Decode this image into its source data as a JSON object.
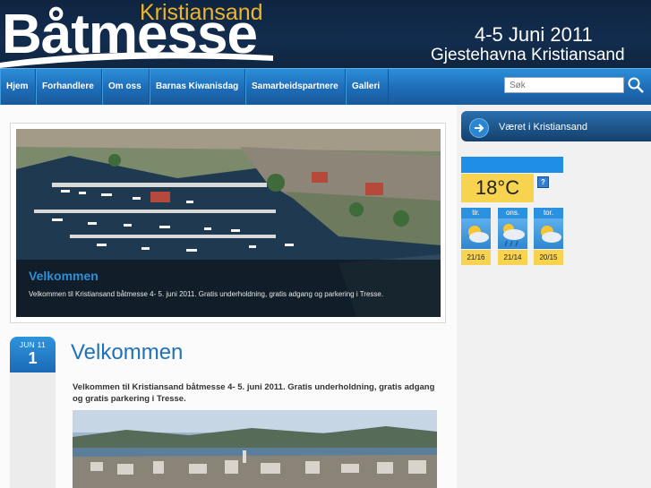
{
  "header": {
    "logo_sub": "Kristiansand",
    "logo_main": "Båtmesse",
    "event_date": "4-5 Juni 2011",
    "event_place": "Gjestehavna Kristiansand"
  },
  "nav": {
    "items": [
      "Hjem",
      "Forhandlere",
      "Om oss",
      "Barnas Kiwanisdag",
      "Samarbeidspartnere",
      "Galleri"
    ],
    "search_placeholder": "Søk"
  },
  "slider": {
    "title": "Velkommen",
    "text": "Velkommen til Kristiansand båtmesse 4- 5. juni 2011. Gratis underholdning, gratis adgang og parkering i Tresse."
  },
  "post": {
    "month": "JUN 11",
    "day": "1",
    "title": "Velkommen",
    "intro": "Velkommen til Kristiansand båtmesse 4- 5. juni 2011. Gratis underholdning, gratis adgang og gratis parkering i Tresse."
  },
  "sidebar": {
    "title": "Været i Kristiansand",
    "temperature": "18°C",
    "help": "?",
    "forecast": [
      {
        "day": "tir.",
        "temps": "21/16",
        "icon": "partly-sunny-icon"
      },
      {
        "day": "ons.",
        "temps": "21/14",
        "icon": "sun-rain-icon"
      },
      {
        "day": "tor.",
        "temps": "20/15",
        "icon": "partly-sunny-icon"
      }
    ]
  },
  "colors": {
    "header_bg": "#132d4f",
    "nav_blue": "#1f6fbb",
    "accent_yellow": "#f0b428",
    "title_blue": "#1f72b8"
  }
}
